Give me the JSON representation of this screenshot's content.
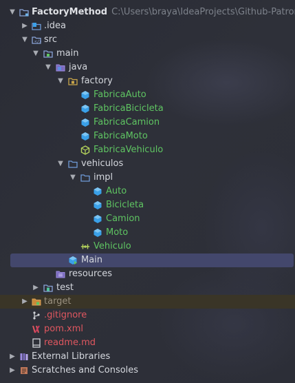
{
  "project": {
    "name": "FactoryMethod",
    "path": "C:\\Users\\braya\\IdeaProjects\\Github-Patrones"
  },
  "tree": {
    "idea": ".idea",
    "src": "src",
    "main": "main",
    "java": "java",
    "factory": "factory",
    "fabrica_auto": "FabricaAuto",
    "fabrica_bicicleta": "FabricaBicicleta",
    "fabrica_camion": "FabricaCamion",
    "fabrica_moto": "FabricaMoto",
    "fabrica_vehiculo": "FabricaVehiculo",
    "vehiculos": "vehiculos",
    "impl": "impl",
    "auto": "Auto",
    "bicicleta": "Bicicleta",
    "camion": "Camion",
    "moto": "Moto",
    "vehiculo": "Vehiculo",
    "main_class": "Main",
    "resources": "resources",
    "test": "test",
    "target": "target",
    "gitignore": ".gitignore",
    "pom": "pom.xml",
    "readme": "readme.md",
    "external_libraries": "External Libraries",
    "scratches": "Scratches and Consoles"
  },
  "colors": {
    "background": "#2b2d30",
    "selection": "#43476c",
    "new_file_green": "#5fc562",
    "untracked_red": "#e0575f",
    "class_icon": "#3aa0e8",
    "interface_icon": "#b5d45c",
    "folder_icon": "#6f9bd8"
  }
}
